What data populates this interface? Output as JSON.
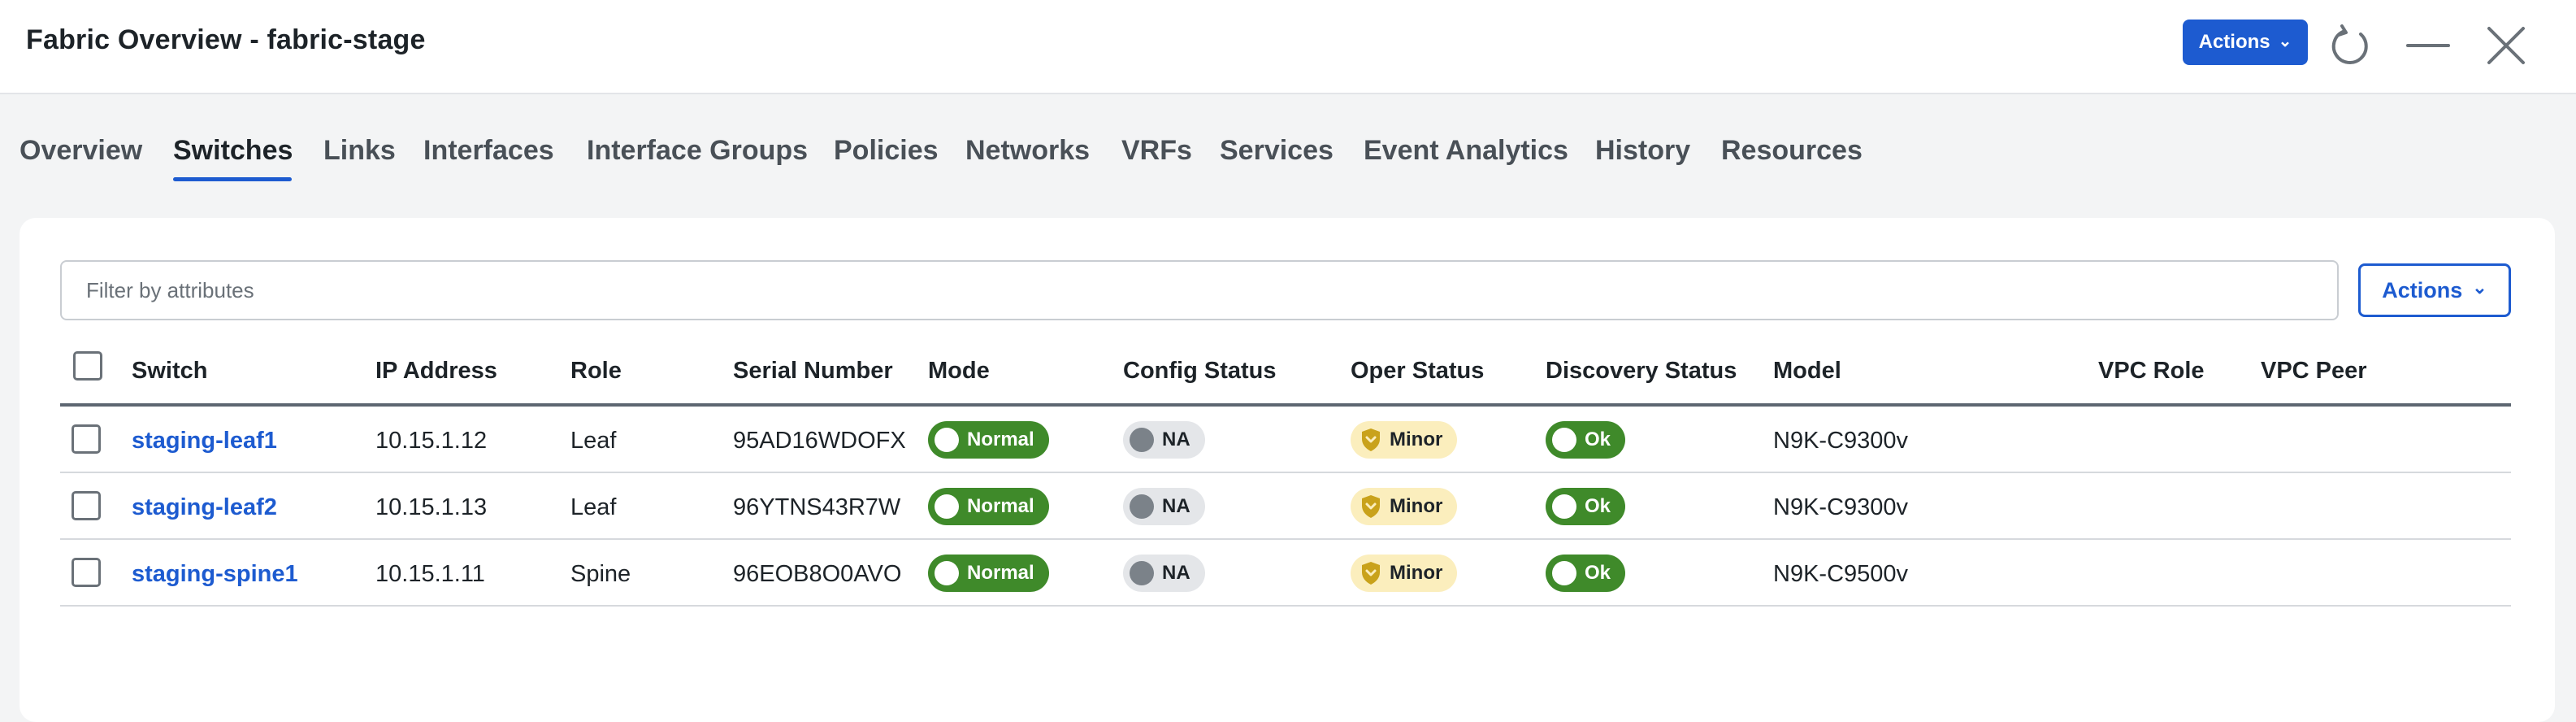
{
  "window": {
    "title": "Fabric Overview - fabric-stage",
    "actions_label": "Actions",
    "refresh_icon": "refresh-icon",
    "minimize_icon": "minimize-icon",
    "close_icon": "close-icon"
  },
  "tabs": [
    {
      "label": "Overview"
    },
    {
      "label": "Switches",
      "active": true
    },
    {
      "label": "Links"
    },
    {
      "label": "Interfaces"
    },
    {
      "label": "Interface Groups"
    },
    {
      "label": "Policies"
    },
    {
      "label": "Networks"
    },
    {
      "label": "VRFs"
    },
    {
      "label": "Services"
    },
    {
      "label": "Event Analytics"
    },
    {
      "label": "History"
    },
    {
      "label": "Resources"
    }
  ],
  "filter": {
    "placeholder": "Filter by attributes",
    "value": ""
  },
  "panel_actions_label": "Actions",
  "table": {
    "columns": [
      "Switch",
      "IP Address",
      "Role",
      "Serial Number",
      "Mode",
      "Config Status",
      "Oper Status",
      "Discovery Status",
      "Model",
      "VPC Role",
      "VPC Peer"
    ],
    "rows": [
      {
        "switch": "staging-leaf1",
        "ip": "10.15.1.12",
        "role": "Leaf",
        "serial": "95AD16WDOFX",
        "mode": "Normal",
        "config_status": "NA",
        "oper_status": "Minor",
        "discovery_status": "Ok",
        "model": "N9K-C9300v",
        "vpc_role": "",
        "vpc_peer": ""
      },
      {
        "switch": "staging-leaf2",
        "ip": "10.15.1.13",
        "role": "Leaf",
        "serial": "96YTNS43R7W",
        "mode": "Normal",
        "config_status": "NA",
        "oper_status": "Minor",
        "discovery_status": "Ok",
        "model": "N9K-C9300v",
        "vpc_role": "",
        "vpc_peer": ""
      },
      {
        "switch": "staging-spine1",
        "ip": "10.15.1.11",
        "role": "Spine",
        "serial": "96EOB8O0AVO",
        "mode": "Normal",
        "config_status": "NA",
        "oper_status": "Minor",
        "discovery_status": "Ok",
        "model": "N9K-C9500v",
        "vpc_role": "",
        "vpc_peer": ""
      }
    ]
  },
  "colors": {
    "accent": "#1d5bd0",
    "status_green": "#3f8a2a",
    "status_gray": "#e4e6e9",
    "status_yellow": "#fbeebd",
    "shield_gold": "#c9a21b"
  }
}
